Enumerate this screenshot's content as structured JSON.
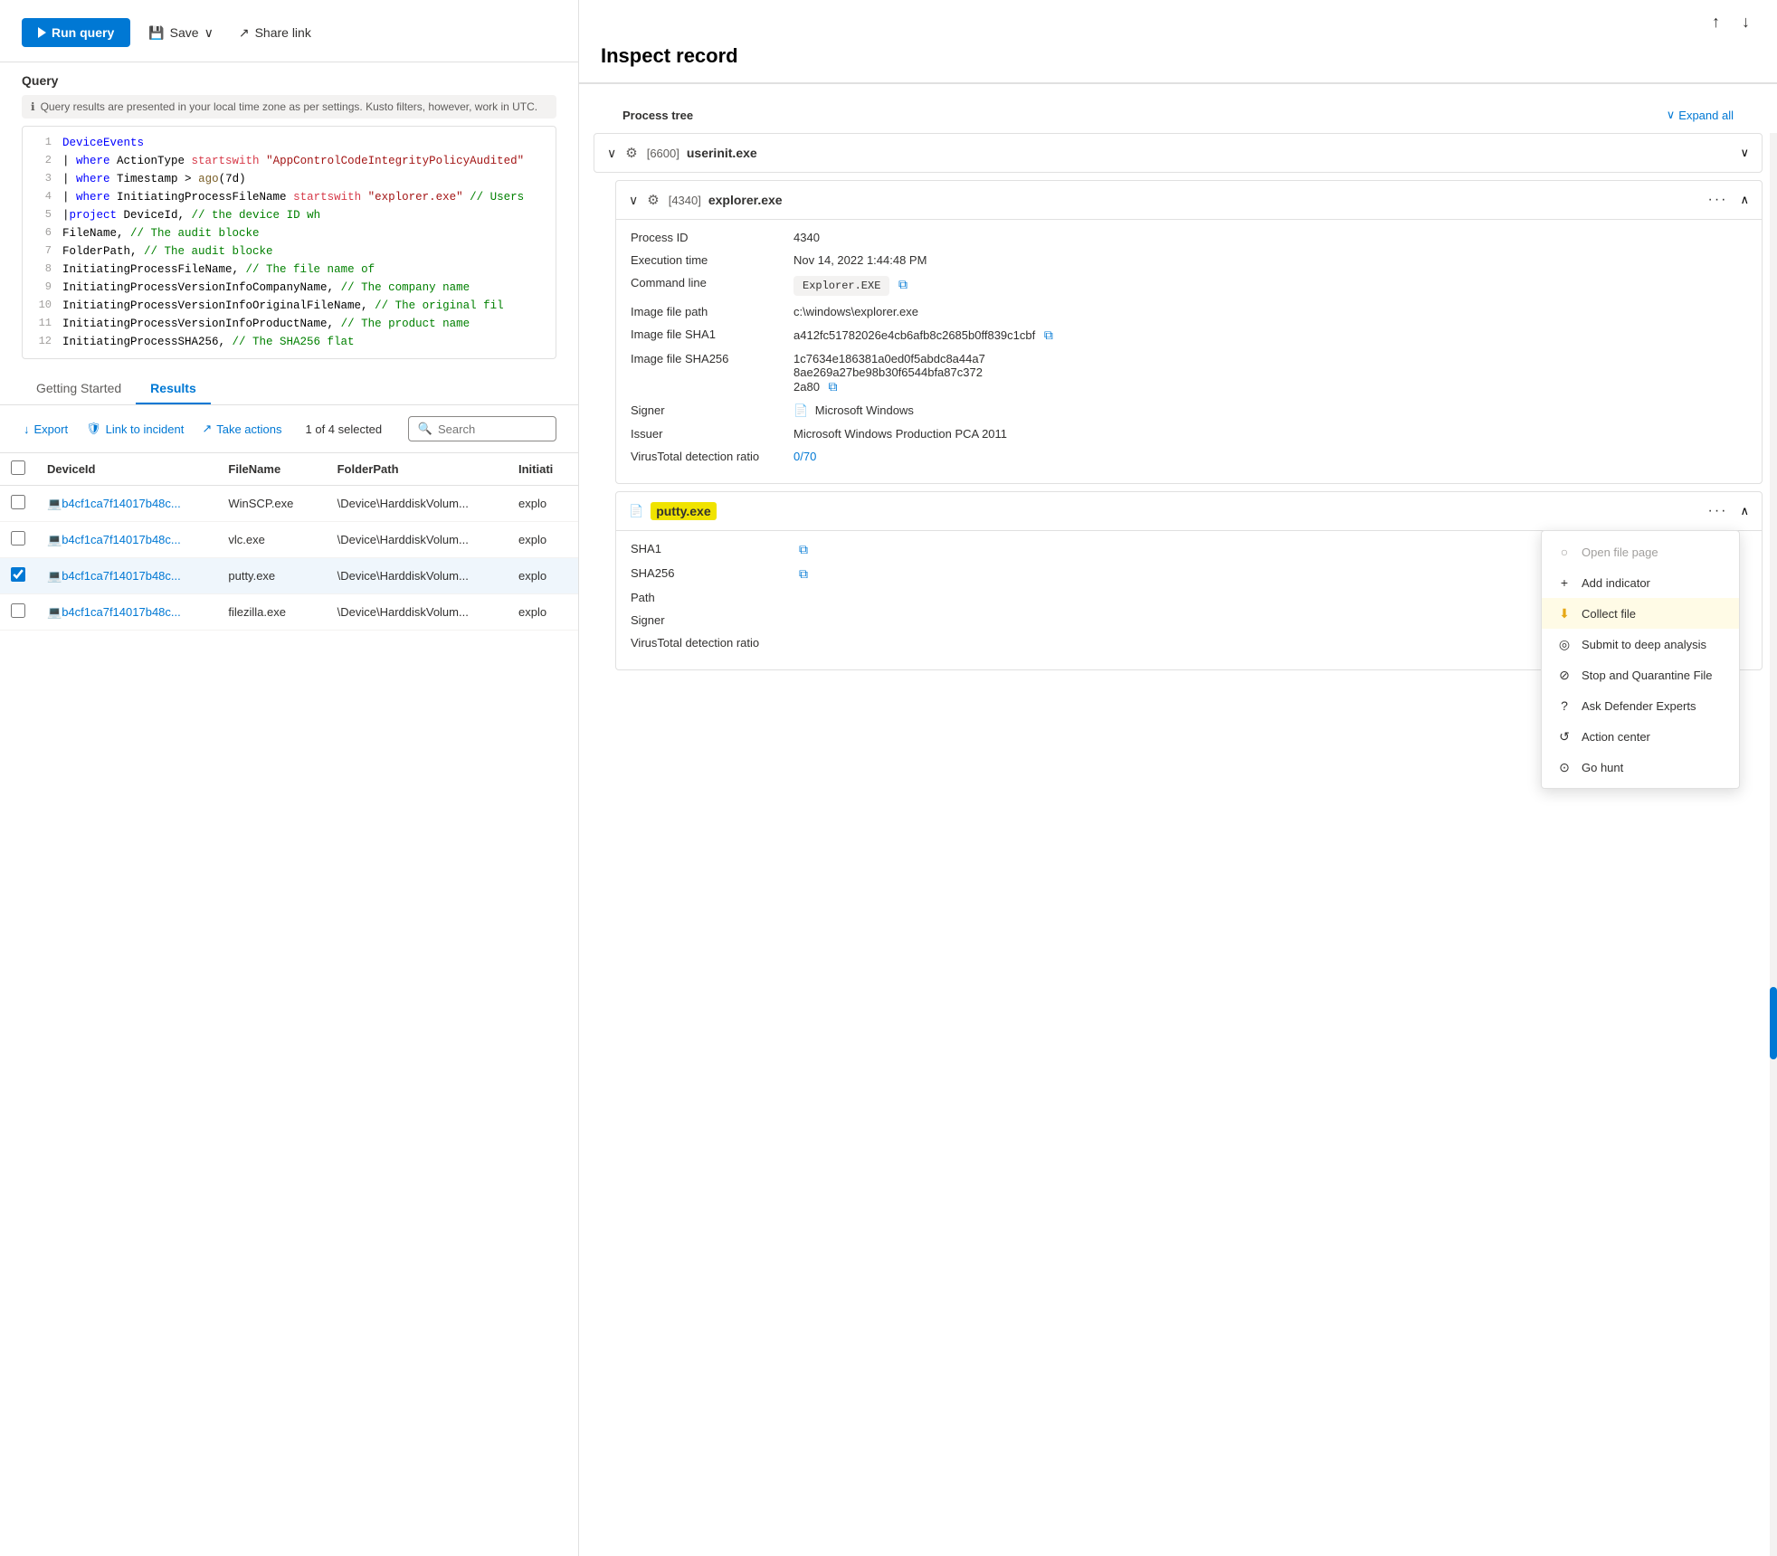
{
  "toolbar": {
    "run_query_label": "Run query",
    "save_label": "Save",
    "share_link_label": "Share link"
  },
  "query_section": {
    "label": "Query",
    "info_text": "Query results are presented in your local time zone as per settings. Kusto filters, however, work in UTC.",
    "lines": [
      {
        "num": 1,
        "text": "DeviceEvents",
        "type": "plain",
        "parts": [
          {
            "t": "kw-blue",
            "v": "DeviceEvents"
          }
        ]
      },
      {
        "num": 2,
        "text": "| where ActionType startswith \"AppControlCodeIntegrityPolicyAudited\"",
        "type": "code",
        "parts": [
          {
            "t": "plain",
            "v": "| "
          },
          {
            "t": "kw-blue",
            "v": "where"
          },
          {
            "t": "plain",
            "v": " ActionType "
          },
          {
            "t": "kw-red",
            "v": "startswith"
          },
          {
            "t": "plain",
            "v": " "
          },
          {
            "t": "str-value",
            "v": "\"AppControlCodeIntegrityPolicyAudited\""
          }
        ]
      },
      {
        "num": 3,
        "text": "| where Timestamp > ago(7d)",
        "parts": [
          {
            "t": "plain",
            "v": "| "
          },
          {
            "t": "kw-blue",
            "v": "where"
          },
          {
            "t": "plain",
            "v": " Timestamp > "
          },
          {
            "t": "fn-name",
            "v": "ago"
          },
          {
            "t": "plain",
            "v": "(7d)"
          }
        ]
      },
      {
        "num": 4,
        "text": "| where InitiatingProcessFileName startswith \"explorer.exe\" // Users",
        "parts": [
          {
            "t": "plain",
            "v": "| "
          },
          {
            "t": "kw-blue",
            "v": "where"
          },
          {
            "t": "plain",
            "v": " InitiatingProcessFileName "
          },
          {
            "t": "kw-red",
            "v": "startswith"
          },
          {
            "t": "plain",
            "v": " "
          },
          {
            "t": "str-value",
            "v": "\"explorer.exe\""
          },
          {
            "t": "plain",
            "v": " "
          },
          {
            "t": "kw-comment",
            "v": "// Users"
          }
        ]
      },
      {
        "num": 5,
        "text": "|project DeviceId,                             // the device ID wh",
        "parts": [
          {
            "t": "plain",
            "v": "|"
          },
          {
            "t": "kw-blue",
            "v": "project"
          },
          {
            "t": "plain",
            "v": " DeviceId,                             "
          },
          {
            "t": "kw-comment",
            "v": "// the device ID wh"
          }
        ]
      },
      {
        "num": 6,
        "text": "FileName,                                       // The audit blocke",
        "parts": [
          {
            "t": "plain",
            "v": "FileName,                                       "
          },
          {
            "t": "kw-comment",
            "v": "// The audit blocke"
          }
        ]
      },
      {
        "num": 7,
        "text": "FolderPath,                                     // The audit blocke",
        "parts": [
          {
            "t": "plain",
            "v": "FolderPath,                                     "
          },
          {
            "t": "kw-comment",
            "v": "// The audit blocke"
          }
        ]
      },
      {
        "num": 8,
        "text": "InitiatingProcessFileName,                      // The file name of",
        "parts": [
          {
            "t": "plain",
            "v": "InitiatingProcessFileName,                      "
          },
          {
            "t": "kw-comment",
            "v": "// The file name of"
          }
        ]
      },
      {
        "num": 9,
        "text": "InitiatingProcessVersionInfoCompanyName,        // The company name",
        "parts": [
          {
            "t": "plain",
            "v": "InitiatingProcessVersionInfoCompanyName,        "
          },
          {
            "t": "kw-comment",
            "v": "// The company name"
          }
        ]
      },
      {
        "num": 10,
        "text": "InitiatingProcessVersionInfoOriginalFileName,   // The original fil",
        "parts": [
          {
            "t": "plain",
            "v": "InitiatingProcessVersionInfoOriginalFileName,   "
          },
          {
            "t": "kw-comment",
            "v": "// The original fil"
          }
        ]
      },
      {
        "num": 11,
        "text": "InitiatingProcessVersionInfoProductName,        // The product name",
        "parts": [
          {
            "t": "plain",
            "v": "InitiatingProcessVersionInfoProductName,        "
          },
          {
            "t": "kw-comment",
            "v": "// The product name"
          }
        ]
      },
      {
        "num": 12,
        "text": "InitiatingProcessSHA256,                        // The SHA256 flat",
        "parts": [
          {
            "t": "plain",
            "v": "InitiatingProcessSHA256,                        "
          },
          {
            "t": "kw-comment",
            "v": "// The SHA256 flat"
          }
        ]
      }
    ]
  },
  "tabs": {
    "getting_started": "Getting Started",
    "results": "Results"
  },
  "results_toolbar": {
    "export_label": "Export",
    "link_to_incident_label": "Link to incident",
    "take_actions_label": "Take actions",
    "selected_count": "1 of 4 selected",
    "search_placeholder": "Search"
  },
  "table": {
    "headers": [
      "DeviceId",
      "FileName",
      "FolderPath",
      "Initiati"
    ],
    "rows": [
      {
        "checked": false,
        "device_id": "b4cf1ca7f14017b48c...",
        "filename": "WinSCP.exe",
        "folder_path": "\\Device\\HarddiskVolum...",
        "initiating": "explo"
      },
      {
        "checked": false,
        "device_id": "b4cf1ca7f14017b48c...",
        "filename": "vlc.exe",
        "folder_path": "\\Device\\HarddiskVolum...",
        "initiating": "explo"
      },
      {
        "checked": true,
        "device_id": "b4cf1ca7f14017b48c...",
        "filename": "putty.exe",
        "folder_path": "\\Device\\HarddiskVolum...",
        "initiating": "explo"
      },
      {
        "checked": false,
        "device_id": "b4cf1ca7f14017b48c...",
        "filename": "filezilla.exe",
        "folder_path": "\\Device\\HarddiskVolum...",
        "initiating": "explo"
      }
    ]
  },
  "inspect_record": {
    "title": "Inspect record",
    "process_tree_label": "Process tree",
    "expand_all_label": "Expand all",
    "nav_up": "↑",
    "nav_down": "↓",
    "processes": [
      {
        "id": "6600",
        "name": "userinit.exe",
        "expanded": false
      },
      {
        "id": "4340",
        "name": "explorer.exe",
        "expanded": true,
        "details": {
          "process_id_label": "Process ID",
          "process_id_value": "4340",
          "execution_time_label": "Execution time",
          "execution_time_value": "Nov 14, 2022 1:44:48 PM",
          "command_line_label": "Command line",
          "command_line_value": "Explorer.EXE",
          "image_file_path_label": "Image file path",
          "image_file_path_value": "c:\\windows\\explorer.exe",
          "image_file_sha1_label": "Image file SHA1",
          "image_file_sha1_value": "a412fc51782026e4cb6afb8c2685b0ff839c1cbf",
          "image_file_sha256_label": "Image file SHA256",
          "image_file_sha256_value": "1c7634e186381a0ed0f5abdc8a44a78ae269a27be98b30f6544bfa87c3722a80",
          "signer_label": "Signer",
          "signer_value": "Microsoft Windows",
          "issuer_label": "Issuer",
          "issuer_value": "Microsoft Windows Production PCA 2011",
          "virus_total_label": "VirusTotal detection ratio",
          "virus_total_value": "0/70"
        }
      }
    ],
    "putty_process": {
      "name": "putty.exe",
      "sha1_label": "SHA1",
      "sha256_label": "SHA256",
      "path_label": "Path",
      "signer_label": "Signer",
      "virus_total_label": "VirusTotal detection ratio"
    },
    "context_menu": {
      "items": [
        {
          "id": "open-file-page",
          "label": "Open file page",
          "icon": "○",
          "disabled": true
        },
        {
          "id": "add-indicator",
          "label": "Add indicator",
          "icon": "+"
        },
        {
          "id": "collect-file",
          "label": "Collect file",
          "icon": "⬇",
          "active": true
        },
        {
          "id": "submit-deep-analysis",
          "label": "Submit to deep analysis",
          "icon": "◎"
        },
        {
          "id": "stop-quarantine",
          "label": "Stop and Quarantine File",
          "icon": "⊘"
        },
        {
          "id": "ask-defender",
          "label": "Ask Defender Experts",
          "icon": "?"
        },
        {
          "id": "action-center",
          "label": "Action center",
          "icon": "↺"
        },
        {
          "id": "go-hunt",
          "label": "Go hunt",
          "icon": "⊙"
        }
      ]
    }
  }
}
